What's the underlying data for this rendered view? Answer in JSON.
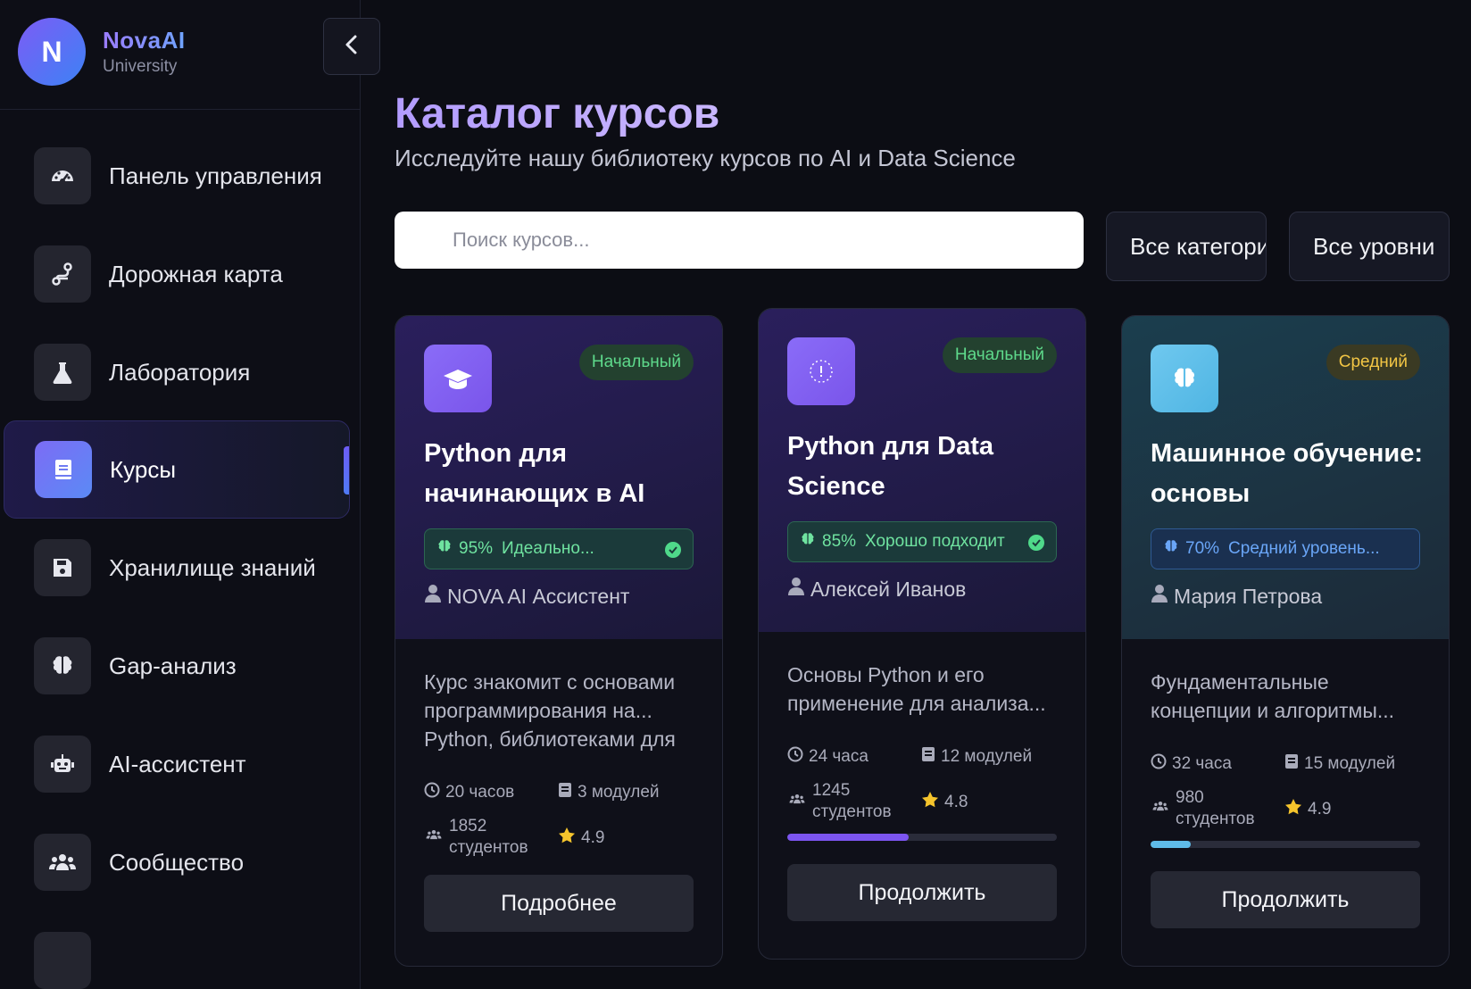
{
  "brand": {
    "initial": "N",
    "name": "NovaAI",
    "subtitle": "University"
  },
  "sidebar": {
    "items": [
      {
        "label": "Панель управления",
        "icon": "gauge-icon"
      },
      {
        "label": "Дорожная карта",
        "icon": "route-icon"
      },
      {
        "label": "Лаборатория",
        "icon": "flask-icon"
      },
      {
        "label": "Курсы",
        "icon": "book-icon",
        "active": true
      },
      {
        "label": "Хранилище знаний",
        "icon": "floppy-icon"
      },
      {
        "label": "Gap-анализ",
        "icon": "brain-icon"
      },
      {
        "label": "AI-ассистент",
        "icon": "robot-icon"
      },
      {
        "label": "Сообщество",
        "icon": "users-icon"
      }
    ]
  },
  "header": {
    "title": "Каталог курсов",
    "subtitle": "Исследуйте нашу библиотеку курсов по AI и Data Science"
  },
  "filters": {
    "search_placeholder": "Поиск курсов...",
    "category": "Все категории",
    "level": "Все уровни"
  },
  "courses": [
    {
      "level": "Начальный",
      "title": "Python для начинающих в AI",
      "match_pct": "95%",
      "match_text": "Идеально...",
      "instructor": "NOVA AI Ассистент",
      "description": "Курс знакомит с основами программирования на... Python, библиотеками для",
      "hours": "20 часов",
      "modules": "3 модулей",
      "students": "1852 студентов",
      "rating": "4.9",
      "button": "Подробнее",
      "progress": null
    },
    {
      "level": "Начальный",
      "title": "Python для Data Science",
      "match_pct": "85%",
      "match_text": "Хорошо подходит",
      "instructor": "Алексей Иванов",
      "description": "Основы Python и его применение для анализа...",
      "hours": "24 часа",
      "modules": "12 модулей",
      "students": "1245 студентов",
      "rating": "4.8",
      "button": "Продолжить",
      "progress": 0.45
    },
    {
      "level": "Средний",
      "title": "Машинное обучение: основы",
      "match_pct": "70%",
      "match_text": "Средний уровень...",
      "instructor": "Мария Петрова",
      "description": "Фундаментальные концепции и алгоритмы...",
      "hours": "32 часа",
      "modules": "15 модулей",
      "students": "980 студентов",
      "rating": "4.9",
      "button": "Продолжить",
      "progress": 0.15
    }
  ],
  "colors": {
    "accent": "#7c5cf5",
    "progress_purple": "#7c55f0",
    "progress_sky": "#5fbbe8",
    "star": "#f5c42c"
  }
}
